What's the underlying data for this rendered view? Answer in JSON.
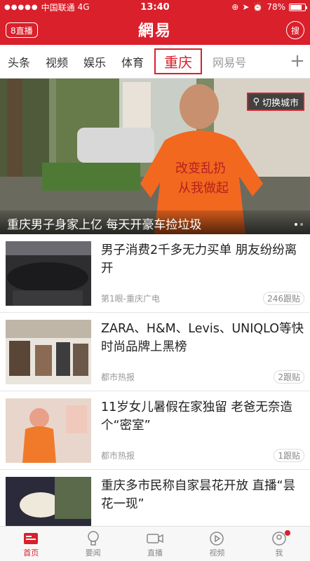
{
  "status_bar": {
    "carrier": "中国联通",
    "network": "4G",
    "time": "13:40",
    "battery_text": "78%",
    "battery_level": 0.78
  },
  "header": {
    "live_label": "8直播",
    "logo": "網易",
    "search_label": "搜"
  },
  "channels": [
    "头条",
    "视频",
    "娱乐",
    "体育",
    "重庆",
    "网易号"
  ],
  "hero": {
    "caption": "重庆男子身家上亿 每天开豪车捡垃圾",
    "city_switch_label": "切换城市",
    "shirt_text_1": "改变乱扔",
    "shirt_text_2": "从我做起"
  },
  "news": [
    {
      "title": "男子消费2千多无力买单 朋友纷纷离开",
      "source": "第1眼-重庆广电",
      "replies": "246跟贴"
    },
    {
      "title": "ZARA、H&M、Levis、UNIQLO等快时尚品牌上黑榜",
      "source": "都市热报",
      "replies": "2跟贴"
    },
    {
      "title": "11岁女儿暑假在家独留 老爸无奈造个“密室”",
      "source": "都市热报",
      "replies": "1跟贴"
    },
    {
      "title": "重庆多市民称自家昙花开放 直播“昙花一现”",
      "source": "",
      "replies": ""
    }
  ],
  "tabbar": [
    {
      "label": "首页",
      "icon": "news-home-icon"
    },
    {
      "label": "要闻",
      "icon": "lightbulb-icon"
    },
    {
      "label": "直播",
      "icon": "video-camera-icon"
    },
    {
      "label": "视频",
      "icon": "play-circle-icon"
    },
    {
      "label": "我",
      "icon": "profile-icon"
    }
  ],
  "colors": {
    "brand": "#d9202b"
  }
}
